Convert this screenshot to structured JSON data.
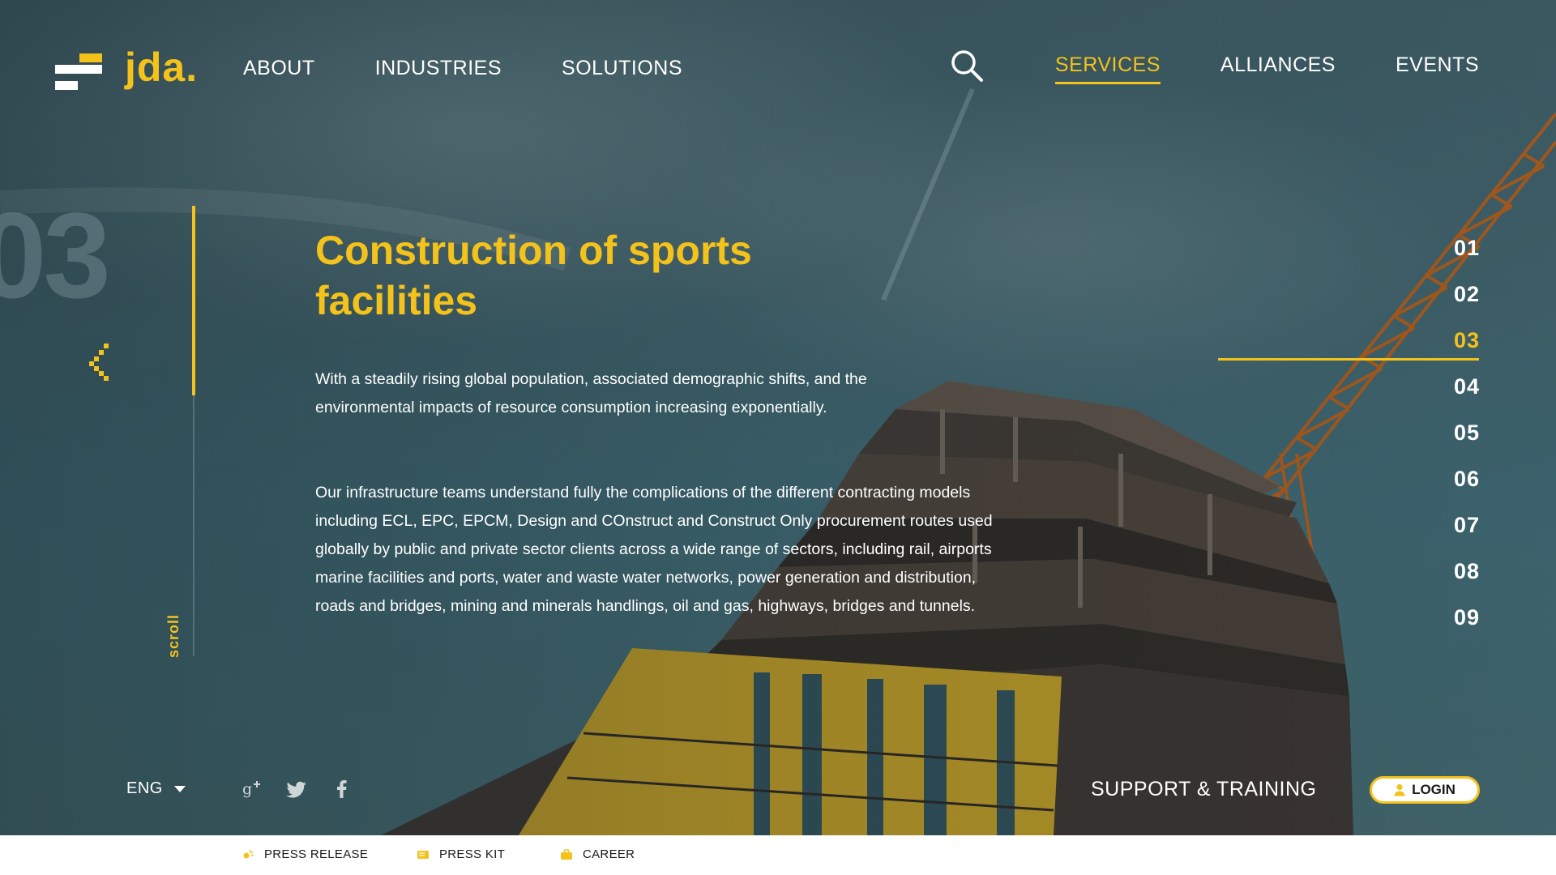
{
  "brand": {
    "name": "jda.",
    "accent_color": "#f3c21b"
  },
  "nav": {
    "left": [
      "ABOUT",
      "INDUSTRIES",
      "SOLUTIONS"
    ],
    "right": [
      "SERVICES",
      "ALLIANCES",
      "EVENTS"
    ],
    "active": "SERVICES"
  },
  "slide": {
    "number": "03",
    "title": "Construction of sports facilities",
    "paragraph1": "With a steadily rising global population, associated demographic shifts, and the environmental impacts of resource consumption increasing exponentially.",
    "paragraph2": "Our infrastructure teams understand fully the complications of the different contracting models including ECL, EPC, EPCM, Design and COnstruct and Construct Only procurement routes used globally by public and private sector clients across a wide range of sectors, including rail, airports marine facilities and ports, water and waste water networks, power generation and distribution, roads and bridges, mining and minerals handlings, oil and gas, highways, bridges and tunnels."
  },
  "scroll_label": "scroll",
  "pager": {
    "items": [
      "01",
      "02",
      "03",
      "04",
      "05",
      "06",
      "07",
      "08",
      "09"
    ],
    "active": "03"
  },
  "bottom": {
    "language": "ENG",
    "social_icons": [
      "google-plus-icon",
      "twitter-icon",
      "facebook-icon"
    ],
    "support_label": "SUPPORT & TRAINING",
    "login_label": "LOGIN"
  },
  "footer": {
    "items": [
      {
        "label": "PRESS RELEASE",
        "icon": "press-release-icon"
      },
      {
        "label": "PRESS KIT",
        "icon": "press-kit-icon"
      },
      {
        "label": "CAREER",
        "icon": "briefcase-icon"
      }
    ]
  }
}
